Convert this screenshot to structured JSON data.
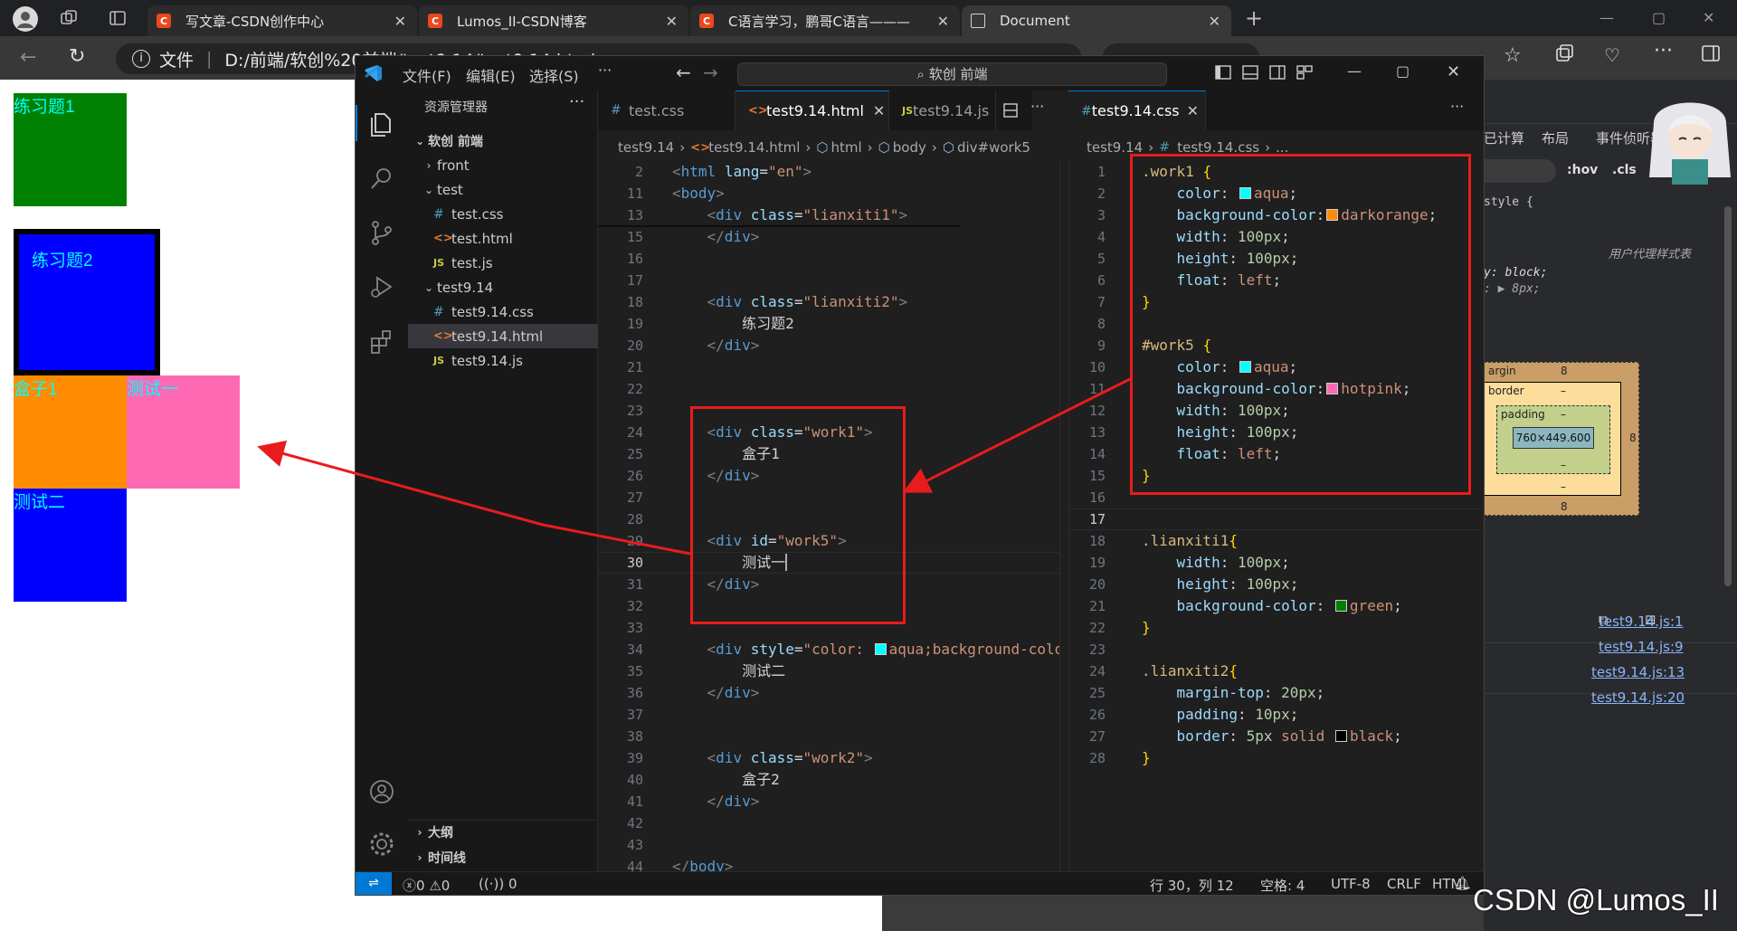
{
  "browser": {
    "tabs": [
      {
        "label": "写文章-CSDN创作中心",
        "icon": "csdn-icon"
      },
      {
        "label": "Lumos_II-CSDN博客",
        "icon": "csdn-icon"
      },
      {
        "label": "C语言学习，鹏哥C语言———",
        "icon": "csdn-icon"
      },
      {
        "label": "Document",
        "icon": "document-icon",
        "active": true
      }
    ],
    "address_prefix": "文件",
    "address": "D:/前端/软创%20前端/test9.14/test9.14.html",
    "page": {
      "box1": "练习题1",
      "box2": "练习题2",
      "box3": "盒子1",
      "box4": "测试一",
      "box5": "测试二"
    }
  },
  "vscode": {
    "menu": [
      "文件(F)",
      "编辑(E)",
      "选择(S)",
      "···"
    ],
    "search": "软创 前端",
    "explorer_title": "资源管理器",
    "tree": [
      {
        "label": "软创 前端",
        "type": "root"
      },
      {
        "label": "front",
        "type": "folder-closed"
      },
      {
        "label": "test",
        "type": "folder-open"
      },
      {
        "label": "test.css",
        "type": "css"
      },
      {
        "label": "test.html",
        "type": "html"
      },
      {
        "label": "test.js",
        "type": "js"
      },
      {
        "label": "test9.14",
        "type": "folder-open"
      },
      {
        "label": "test9.14.css",
        "type": "css"
      },
      {
        "label": "test9.14.html",
        "type": "html",
        "selected": true
      },
      {
        "label": "test9.14.js",
        "type": "js"
      }
    ],
    "outline": "大纲",
    "timeline": "时间线",
    "left_tabs": [
      "test.css",
      "test9.14.html",
      "test9.14.js"
    ],
    "right_tab": "test9.14.css",
    "left_breadcrumb": [
      "test9.14",
      "test9.14.html",
      "html",
      "body",
      "div#work5"
    ],
    "right_breadcrumb": [
      "test9.14",
      "test9.14.css",
      "..."
    ],
    "status": {
      "errors": "0",
      "warnings": "0",
      "ports": "0",
      "position": "行 30，列 12",
      "spaces": "空格: 4",
      "encoding": "UTF-8",
      "eol": "CRLF",
      "language": "HTML"
    }
  },
  "devtools": {
    "tabs": [
      "已计算",
      "布局",
      "事件侦听器"
    ],
    "filter_hov": ":hov",
    "filter_cls": ".cls",
    "style_rule": "style {",
    "ua_label": "用户代理样式表",
    "ua_line1": "y: block;",
    "ua_line2": ": ▶ 8px;",
    "margin_label": "argin",
    "margin_value": "8",
    "border_label": "border",
    "padding_label": "padding",
    "content_size": "760×449.600",
    "dash": "–",
    "sources": [
      "test9.14.js:1",
      "test9.14.js:9",
      "test9.14.js:13",
      "test9.14.js:20"
    ]
  },
  "watermark": "CSDN @Lumos_II"
}
